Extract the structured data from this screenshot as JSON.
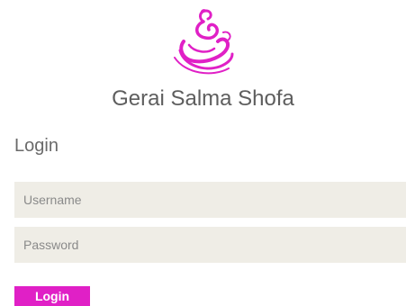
{
  "brand": {
    "name": "Gerai Salma Shofa",
    "logo_icon": "swirl-logo-icon",
    "accent_color": "#e020c6"
  },
  "form": {
    "heading": "Login",
    "username": {
      "placeholder": "Username",
      "value": ""
    },
    "password": {
      "placeholder": "Password",
      "value": ""
    },
    "submit_label": "Login"
  },
  "colors": {
    "field_background": "#efede6",
    "brand_text": "#5e5e5e"
  }
}
